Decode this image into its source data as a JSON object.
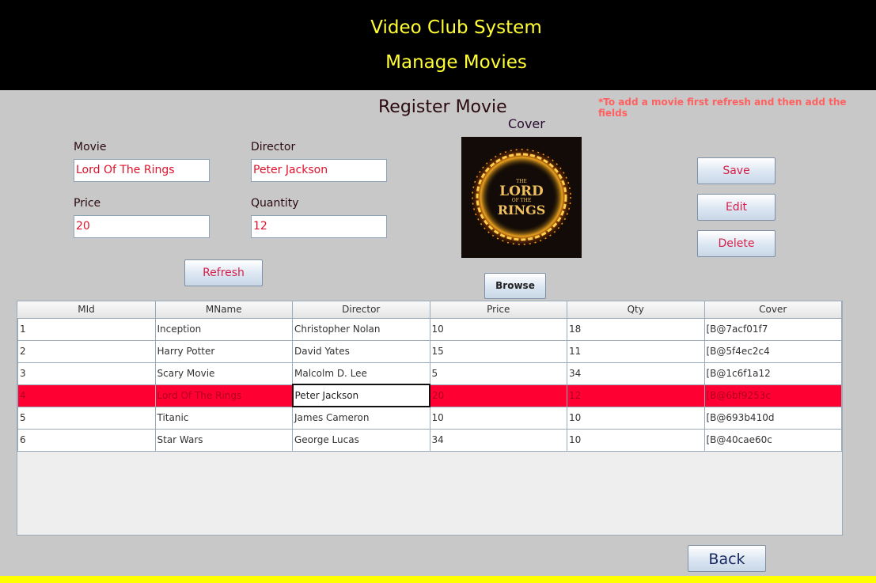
{
  "header": {
    "title": "Video Club System",
    "subtitle": "Manage Movies"
  },
  "form": {
    "title": "Register Movie",
    "note": "*To add a movie first refresh and then add the fields",
    "cover_label": "Cover",
    "movie": {
      "label": "Movie",
      "value": "Lord Of The Rings"
    },
    "director": {
      "label": "Director",
      "value": "Peter Jackson"
    },
    "price": {
      "label": "Price",
      "value": "20"
    },
    "quantity": {
      "label": "Quantity",
      "value": "12"
    },
    "cover_image_text": {
      "line1": "THE",
      "line2": "LORD",
      "line3": "OF THE",
      "line4": "RINGS"
    }
  },
  "buttons": {
    "save": "Save",
    "edit": "Edit",
    "delete": "Delete",
    "refresh": "Refresh",
    "browse": "Browse",
    "back": "Back"
  },
  "table": {
    "columns": [
      "MId",
      "MName",
      "Director",
      "Price",
      "Qty",
      "Cover"
    ],
    "rows": [
      [
        "1",
        "Inception",
        "Christopher Nolan",
        "10",
        "18",
        "[B@7acf01f7"
      ],
      [
        "2",
        "Harry Potter",
        "David Yates",
        "15",
        "11",
        "[B@5f4ec2c4"
      ],
      [
        "3",
        "Scary Movie",
        "Malcolm D. Lee",
        "5",
        "34",
        "[B@1c6f1a12"
      ],
      [
        "4",
        "Lord Of The Rings",
        "Peter Jackson",
        "20",
        "12",
        "[B@6bf9253c"
      ],
      [
        "5",
        "Titanic",
        "James Cameron",
        "10",
        "10",
        "[B@693b410d"
      ],
      [
        "6",
        "Star Wars",
        "George Lucas",
        "34",
        "10",
        "[B@40cae60c"
      ]
    ],
    "selected_row": 3
  },
  "colors": {
    "header_bg": "#000000",
    "header_text": "#ffff33",
    "selection": "#ff0033",
    "footer_bar": "#ffff00"
  }
}
